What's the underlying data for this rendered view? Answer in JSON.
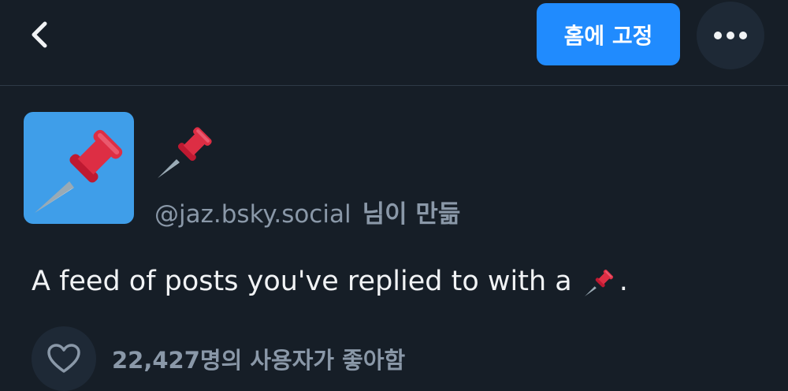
{
  "header": {
    "back_icon": "chevron-left-icon",
    "pin_button_label": "홈에 고정",
    "more_icon": "ellipsis-icon"
  },
  "feed": {
    "avatar_icon": "pushpin-icon",
    "title_icon": "pushpin-emoji",
    "creator_handle": "@jaz.bsky.social",
    "creator_suffix": "님이 만듦",
    "description_text": "A feed of posts you've replied to with a",
    "description_end": ".",
    "description_emoji": "pushpin-emoji",
    "like_icon": "heart-outline-icon",
    "likes_text": "22,427명의 사용자가 좋아함"
  },
  "colors": {
    "background": "#161e27",
    "accent": "#208bfe",
    "avatar_bg": "#3f9ee9",
    "pin_red": "#dd2e44",
    "muted_text": "#8a98a8",
    "primary_text": "#f1f3f5"
  }
}
